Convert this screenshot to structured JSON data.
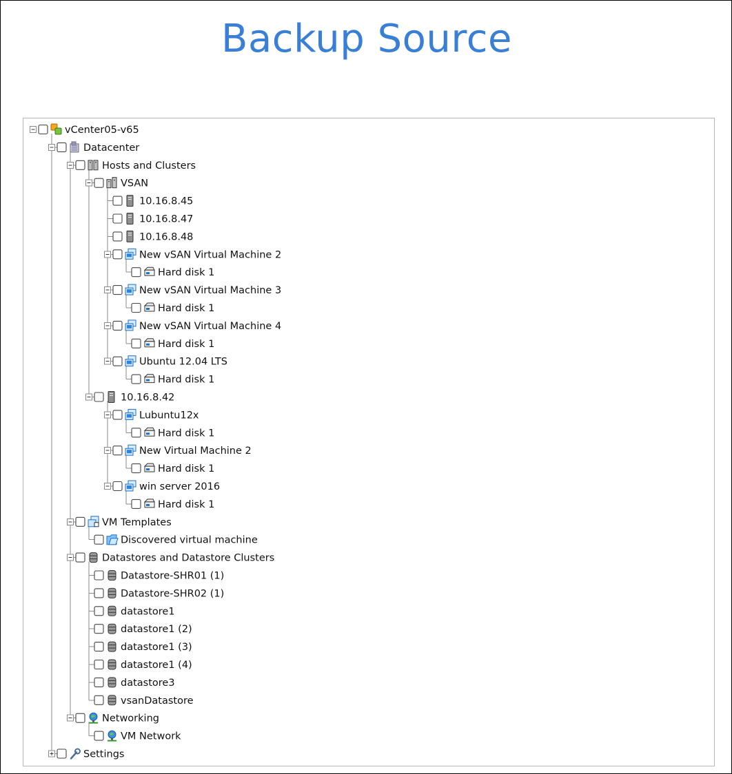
{
  "title": "Backup Source",
  "colors": {
    "title": "#3a7fd6",
    "tree_lines": "#8a8a8a"
  },
  "tree": [
    {
      "label": "vCenter05-v65",
      "depth": 0,
      "icon": "vcenter-icon",
      "expander": "minus"
    },
    {
      "label": "Datacenter",
      "depth": 1,
      "icon": "datacenter-icon",
      "expander": "minus"
    },
    {
      "label": "Hosts and Clusters",
      "depth": 2,
      "icon": "hosts-clusters-icon",
      "expander": "minus"
    },
    {
      "label": "VSAN",
      "depth": 3,
      "icon": "cluster-icon",
      "expander": "minus"
    },
    {
      "label": "10.16.8.45",
      "depth": 4,
      "icon": "host-icon",
      "expander": "none"
    },
    {
      "label": "10.16.8.47",
      "depth": 4,
      "icon": "host-icon",
      "expander": "none"
    },
    {
      "label": "10.16.8.48",
      "depth": 4,
      "icon": "host-icon",
      "expander": "none"
    },
    {
      "label": "New vSAN Virtual Machine 2",
      "depth": 4,
      "icon": "vm-icon",
      "expander": "minus"
    },
    {
      "label": "Hard disk 1",
      "depth": 5,
      "icon": "hard-disk-icon",
      "expander": "none"
    },
    {
      "label": "New vSAN Virtual Machine 3",
      "depth": 4,
      "icon": "vm-icon",
      "expander": "minus"
    },
    {
      "label": "Hard disk 1",
      "depth": 5,
      "icon": "hard-disk-icon",
      "expander": "none"
    },
    {
      "label": "New vSAN Virtual Machine 4",
      "depth": 4,
      "icon": "vm-icon",
      "expander": "minus"
    },
    {
      "label": "Hard disk 1",
      "depth": 5,
      "icon": "hard-disk-icon",
      "expander": "none"
    },
    {
      "label": "Ubuntu 12.04 LTS",
      "depth": 4,
      "icon": "vm-icon",
      "expander": "minus"
    },
    {
      "label": "Hard disk 1",
      "depth": 5,
      "icon": "hard-disk-icon",
      "expander": "none"
    },
    {
      "label": "10.16.8.42",
      "depth": 3,
      "icon": "host-icon",
      "expander": "minus"
    },
    {
      "label": "Lubuntu12x",
      "depth": 4,
      "icon": "vm-icon",
      "expander": "minus"
    },
    {
      "label": "Hard disk 1",
      "depth": 5,
      "icon": "hard-disk-icon",
      "expander": "none"
    },
    {
      "label": "New Virtual Machine 2",
      "depth": 4,
      "icon": "vm-icon",
      "expander": "minus"
    },
    {
      "label": "Hard disk 1",
      "depth": 5,
      "icon": "hard-disk-icon",
      "expander": "none"
    },
    {
      "label": "win server 2016",
      "depth": 4,
      "icon": "vm-icon",
      "expander": "minus"
    },
    {
      "label": "Hard disk 1",
      "depth": 5,
      "icon": "hard-disk-icon",
      "expander": "none"
    },
    {
      "label": "VM Templates",
      "depth": 2,
      "icon": "vm-templates-icon",
      "expander": "minus"
    },
    {
      "label": "Discovered virtual machine",
      "depth": 3,
      "icon": "folder-icon",
      "expander": "none"
    },
    {
      "label": "Datastores and Datastore Clusters",
      "depth": 2,
      "icon": "datastores-icon",
      "expander": "minus"
    },
    {
      "label": "Datastore-SHR01 (1)",
      "depth": 3,
      "icon": "datastore-icon",
      "expander": "none"
    },
    {
      "label": "Datastore-SHR02 (1)",
      "depth": 3,
      "icon": "datastore-icon",
      "expander": "none"
    },
    {
      "label": "datastore1",
      "depth": 3,
      "icon": "datastore-icon",
      "expander": "none"
    },
    {
      "label": "datastore1 (2)",
      "depth": 3,
      "icon": "datastore-icon",
      "expander": "none"
    },
    {
      "label": "datastore1 (3)",
      "depth": 3,
      "icon": "datastore-icon",
      "expander": "none"
    },
    {
      "label": "datastore1 (4)",
      "depth": 3,
      "icon": "datastore-icon",
      "expander": "none"
    },
    {
      "label": "datastore3",
      "depth": 3,
      "icon": "datastore-icon",
      "expander": "none"
    },
    {
      "label": "vsanDatastore",
      "depth": 3,
      "icon": "datastore-icon",
      "expander": "none"
    },
    {
      "label": "Networking",
      "depth": 2,
      "icon": "networking-icon",
      "expander": "minus"
    },
    {
      "label": "VM Network",
      "depth": 3,
      "icon": "network-icon",
      "expander": "none"
    },
    {
      "label": "Settings",
      "depth": 1,
      "icon": "settings-icon",
      "expander": "plus"
    }
  ]
}
